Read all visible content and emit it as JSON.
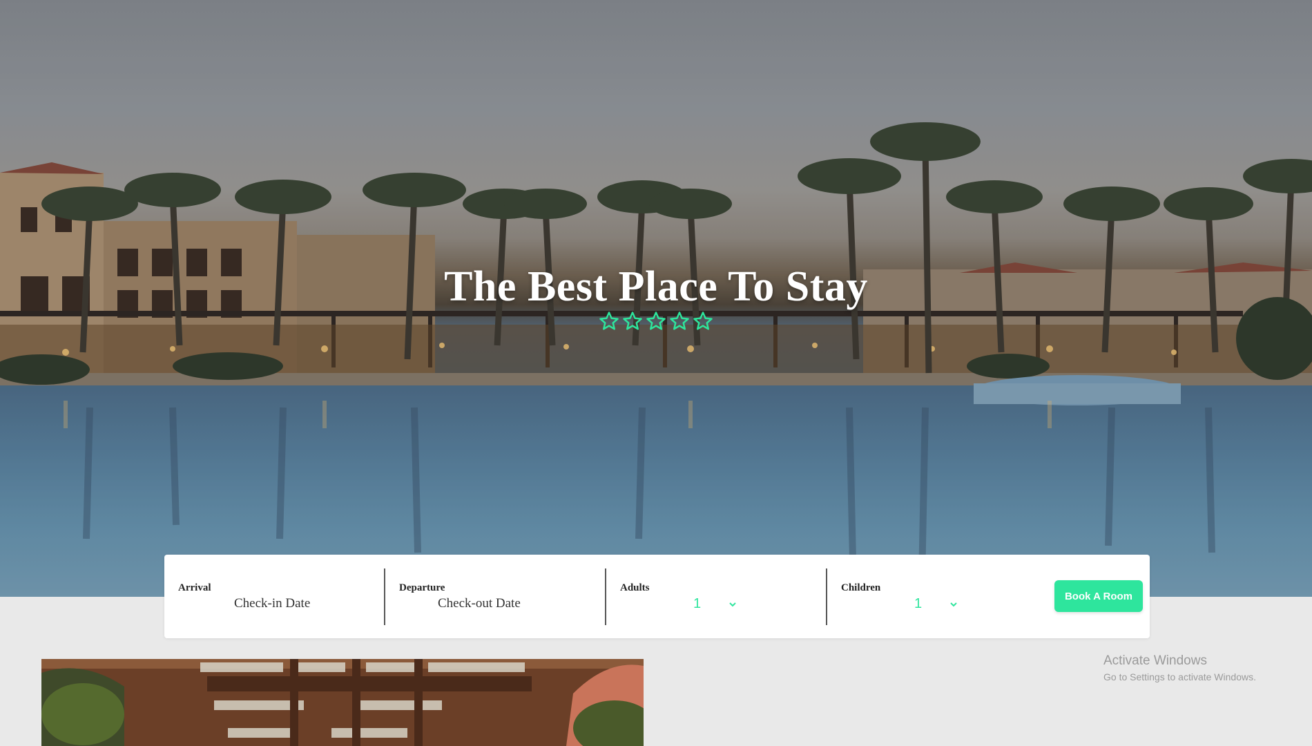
{
  "hero": {
    "title": "The Best Place To Stay",
    "star_count": 5,
    "star_color": "#2ee59d"
  },
  "booking": {
    "arrival": {
      "label": "Arrival",
      "value": "Check-in Date"
    },
    "departure": {
      "label": "Departure",
      "value": "Check-out Date"
    },
    "adults": {
      "label": "Adults",
      "value": "1"
    },
    "children": {
      "label": "Children",
      "value": "1"
    },
    "button_label": "Book A Room",
    "accent_color": "#2ee59d"
  },
  "watermark": {
    "title": "Activate Windows",
    "subtitle": "Go to Settings to activate Windows."
  }
}
